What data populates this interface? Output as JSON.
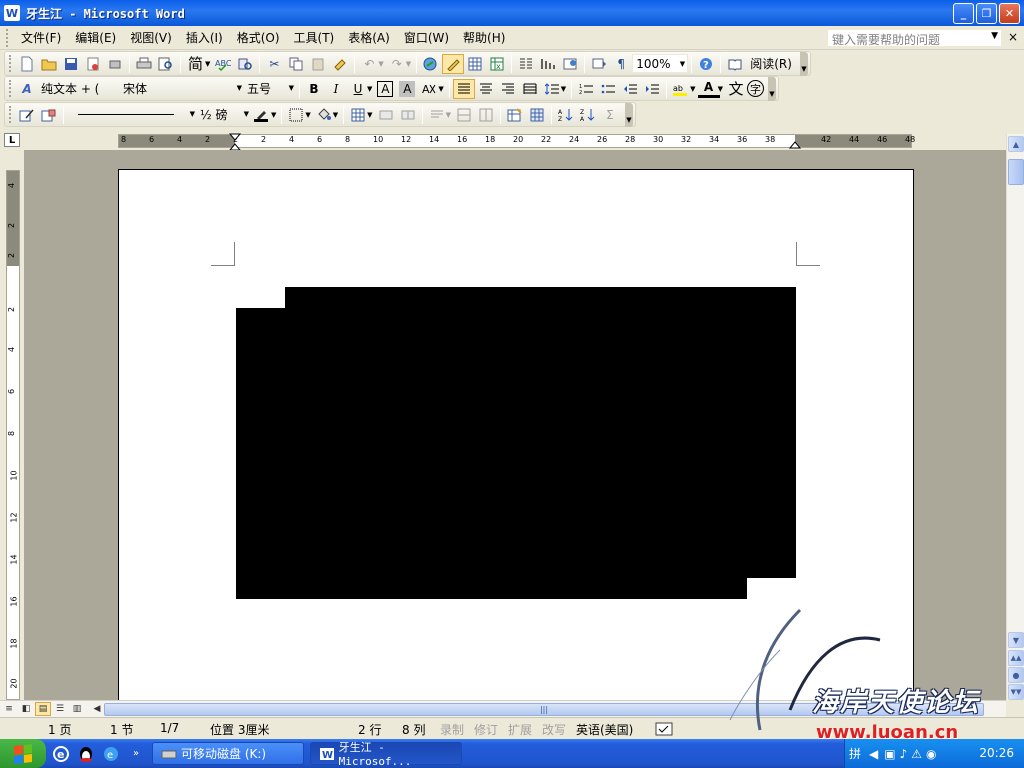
{
  "window": {
    "icon": "W",
    "title": "牙生江 - Microsoft Word",
    "buttons": {
      "minimize": "_",
      "restore": "❐",
      "close": "✕"
    }
  },
  "menu": {
    "items": [
      "文件(F)",
      "编辑(E)",
      "视图(V)",
      "插入(I)",
      "格式(O)",
      "工具(T)",
      "表格(A)",
      "窗口(W)",
      "帮助(H)"
    ],
    "help_placeholder": "键入需要帮助的问题",
    "doc_close": "×"
  },
  "standard_toolbar": {
    "simplified_label": "简",
    "zoom": "100%",
    "read_label": "阅读(R)"
  },
  "format_toolbar": {
    "style": "纯文本 + (",
    "font": "宋体",
    "size": "五号",
    "bold": "B",
    "italic": "I",
    "underline": "U",
    "border_char": "A",
    "shade_char": "A",
    "font_color": "A",
    "phonetic": "文",
    "enclose": "字"
  },
  "drawing_toolbar": {
    "line_weight": "½ 磅",
    "sum": "Σ"
  },
  "ruler": {
    "corner": "L",
    "h_labels": [
      "8",
      "6",
      "4",
      "2",
      "2",
      "2",
      "4",
      "6",
      "8",
      "10",
      "12",
      "14",
      "16",
      "18",
      "20",
      "22",
      "24",
      "26",
      "28",
      "30",
      "32",
      "34",
      "36",
      "38",
      "42",
      "44",
      "46",
      "48"
    ],
    "v_labels": [
      "4",
      "2",
      "2",
      "2",
      "4",
      "6",
      "8",
      "10",
      "12",
      "14",
      "16",
      "18",
      "20"
    ]
  },
  "statusbar": {
    "page": "1 页",
    "section": "1 节",
    "page_of": "1/7",
    "position": "位置 3厘米",
    "line": "2 行",
    "column": "8 列",
    "rec": "录制",
    "trk": "修订",
    "ext": "扩展",
    "ovr": "改写",
    "language": "英语(美国)"
  },
  "watermark": {
    "text": "海岸天使论坛",
    "url": "www.luoan.cn"
  },
  "taskbar": {
    "tasks": [
      "可移动磁盘 (K:)",
      "牙生江 - Microsof..."
    ],
    "clock": "20:26",
    "tray_ime": "拼"
  }
}
